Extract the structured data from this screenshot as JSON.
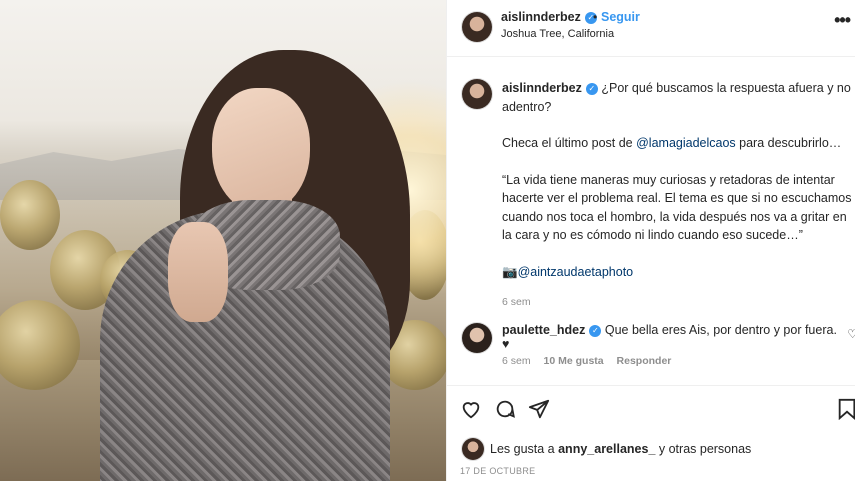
{
  "post": {
    "username": "aislinnderbez",
    "follow_label": "Seguir",
    "separator": "•",
    "location": "Joshua Tree, California",
    "more_label": "•••"
  },
  "caption": {
    "username": "aislinnderbez",
    "line1": "¿Por qué buscamos la respuesta afuera y no adentro?",
    "line2_prefix": "Checa el último post de ",
    "line2_mention": "@lamagiadelcaos",
    "line2_suffix": " para descubrirlo…",
    "quote": "“La vida tiene maneras muy curiosas y retadoras de intentar hacerte ver el problema real. El tema es que si no escuchamos cuando nos toca el hombro, la vida después nos va a gritar en la cara y no es cómodo ni lindo cuando eso sucede…”",
    "photo_credit": "📷@aintzaudaetaphoto",
    "time": "6 sem"
  },
  "comment": {
    "username": "paulette_hdez",
    "text": "Que bella eres Ais, por dentro y por fuera. ♥",
    "time": "6 sem",
    "likes": "10 Me gusta",
    "reply": "Responder"
  },
  "likes_line": {
    "prefix": "Les gusta a ",
    "user": "anny_arellanes_",
    "suffix": " y otras personas"
  },
  "date": "17 DE OCTUBRE",
  "icons": [
    "heart-icon",
    "comment-icon",
    "share-icon",
    "bookmark-icon",
    "verified-icon",
    "more-icon"
  ]
}
